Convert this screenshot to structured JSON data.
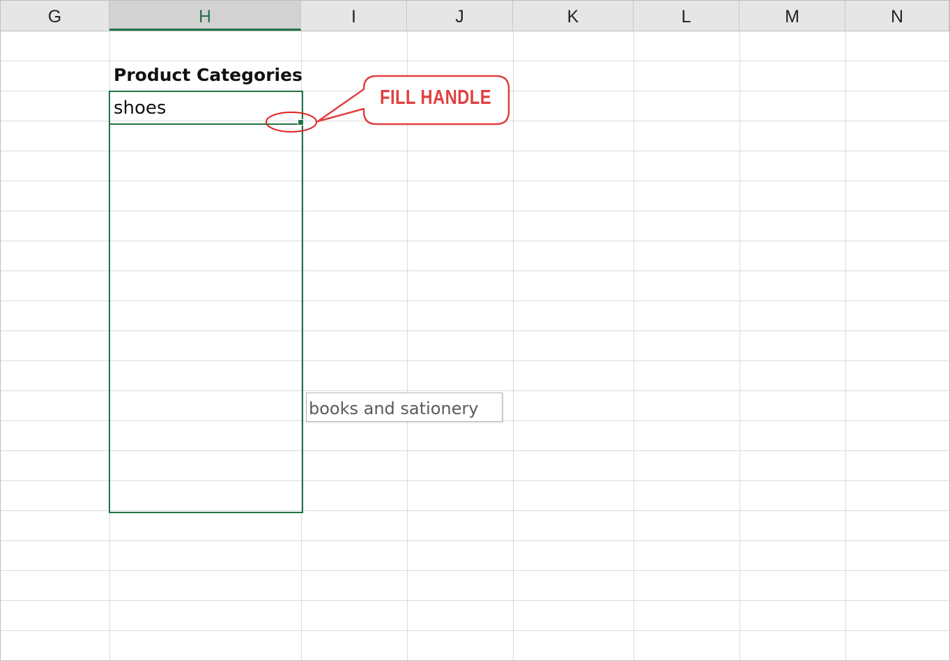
{
  "columns": [
    {
      "label": "G",
      "selected": false
    },
    {
      "label": "H",
      "selected": true
    },
    {
      "label": "I",
      "selected": false
    },
    {
      "label": "J",
      "selected": false
    },
    {
      "label": "K",
      "selected": false
    },
    {
      "label": "L",
      "selected": false
    },
    {
      "label": "M",
      "selected": false
    },
    {
      "label": "N",
      "selected": false
    }
  ],
  "cells": {
    "header": "Product Categories",
    "value": "shoes"
  },
  "fill_tooltip": "books and sationery",
  "callout": {
    "label": "FILL HANDLE"
  },
  "colors": {
    "selection": "#217346",
    "callout": "#e04040",
    "header_bg": "#e6e6e6",
    "gridline": "#dadada"
  }
}
